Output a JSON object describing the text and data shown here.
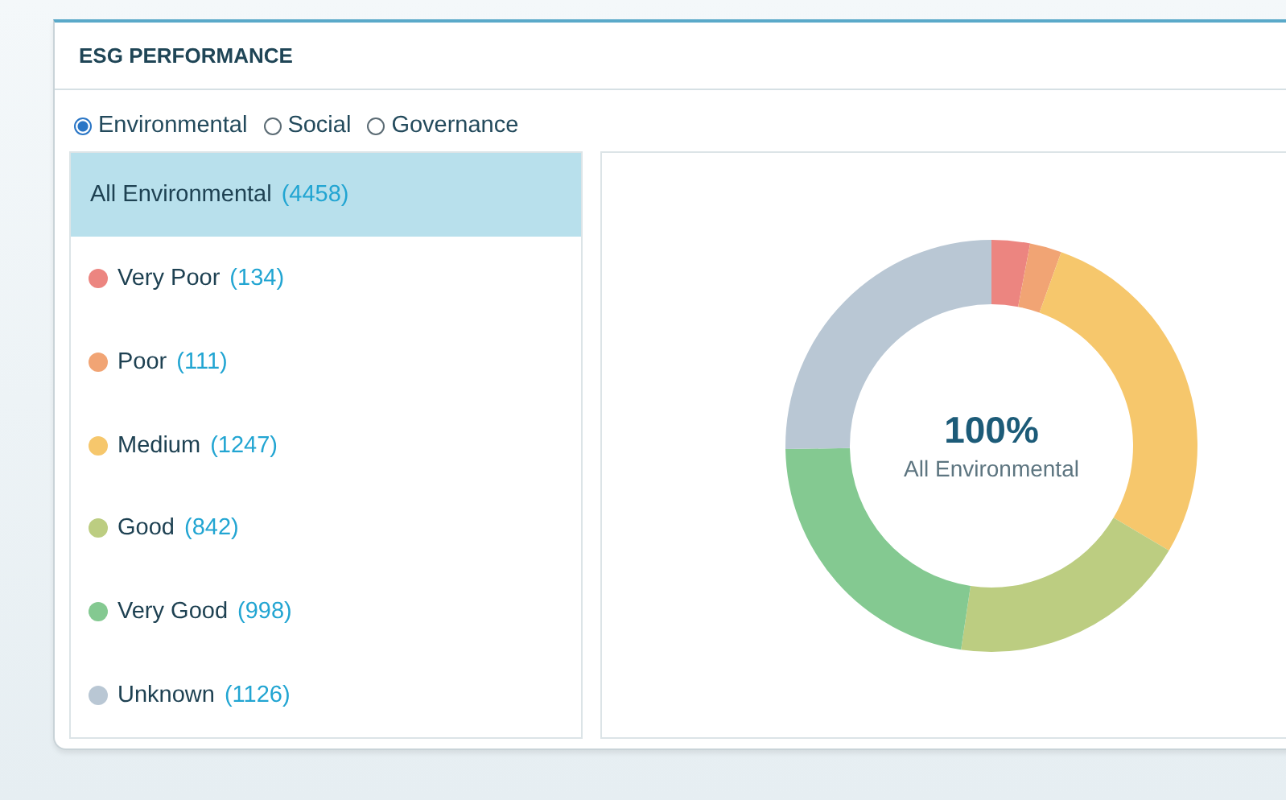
{
  "panel": {
    "title": "ESG PERFORMANCE"
  },
  "radios": [
    {
      "label": "Environmental",
      "selected": true
    },
    {
      "label": "Social",
      "selected": false
    },
    {
      "label": "Governance",
      "selected": false
    }
  ],
  "categories": [
    {
      "label": "All Environmental",
      "count": "(4458)",
      "selected": true
    },
    {
      "label": "Very Poor",
      "count": "(134)",
      "selected": false,
      "color": "#ec8580"
    },
    {
      "label": "Poor",
      "count": "(111)",
      "selected": false,
      "color": "#f1a474"
    },
    {
      "label": "Medium",
      "count": "(1247)",
      "selected": false,
      "color": "#f6c76c"
    },
    {
      "label": "Good",
      "count": "(842)",
      "selected": false,
      "color": "#bccd81"
    },
    {
      "label": "Very Good",
      "count": "(998)",
      "selected": false,
      "color": "#84c991"
    },
    {
      "label": "Unknown",
      "count": "(1126)",
      "selected": false,
      "color": "#b9c7d4"
    }
  ],
  "chart": {
    "center_value": "100%",
    "center_label": "All Environmental",
    "chart_data": {
      "type": "donut",
      "values": [
        3.01,
        2.49,
        27.97,
        18.89,
        22.39,
        25.25
      ]
    }
  }
}
